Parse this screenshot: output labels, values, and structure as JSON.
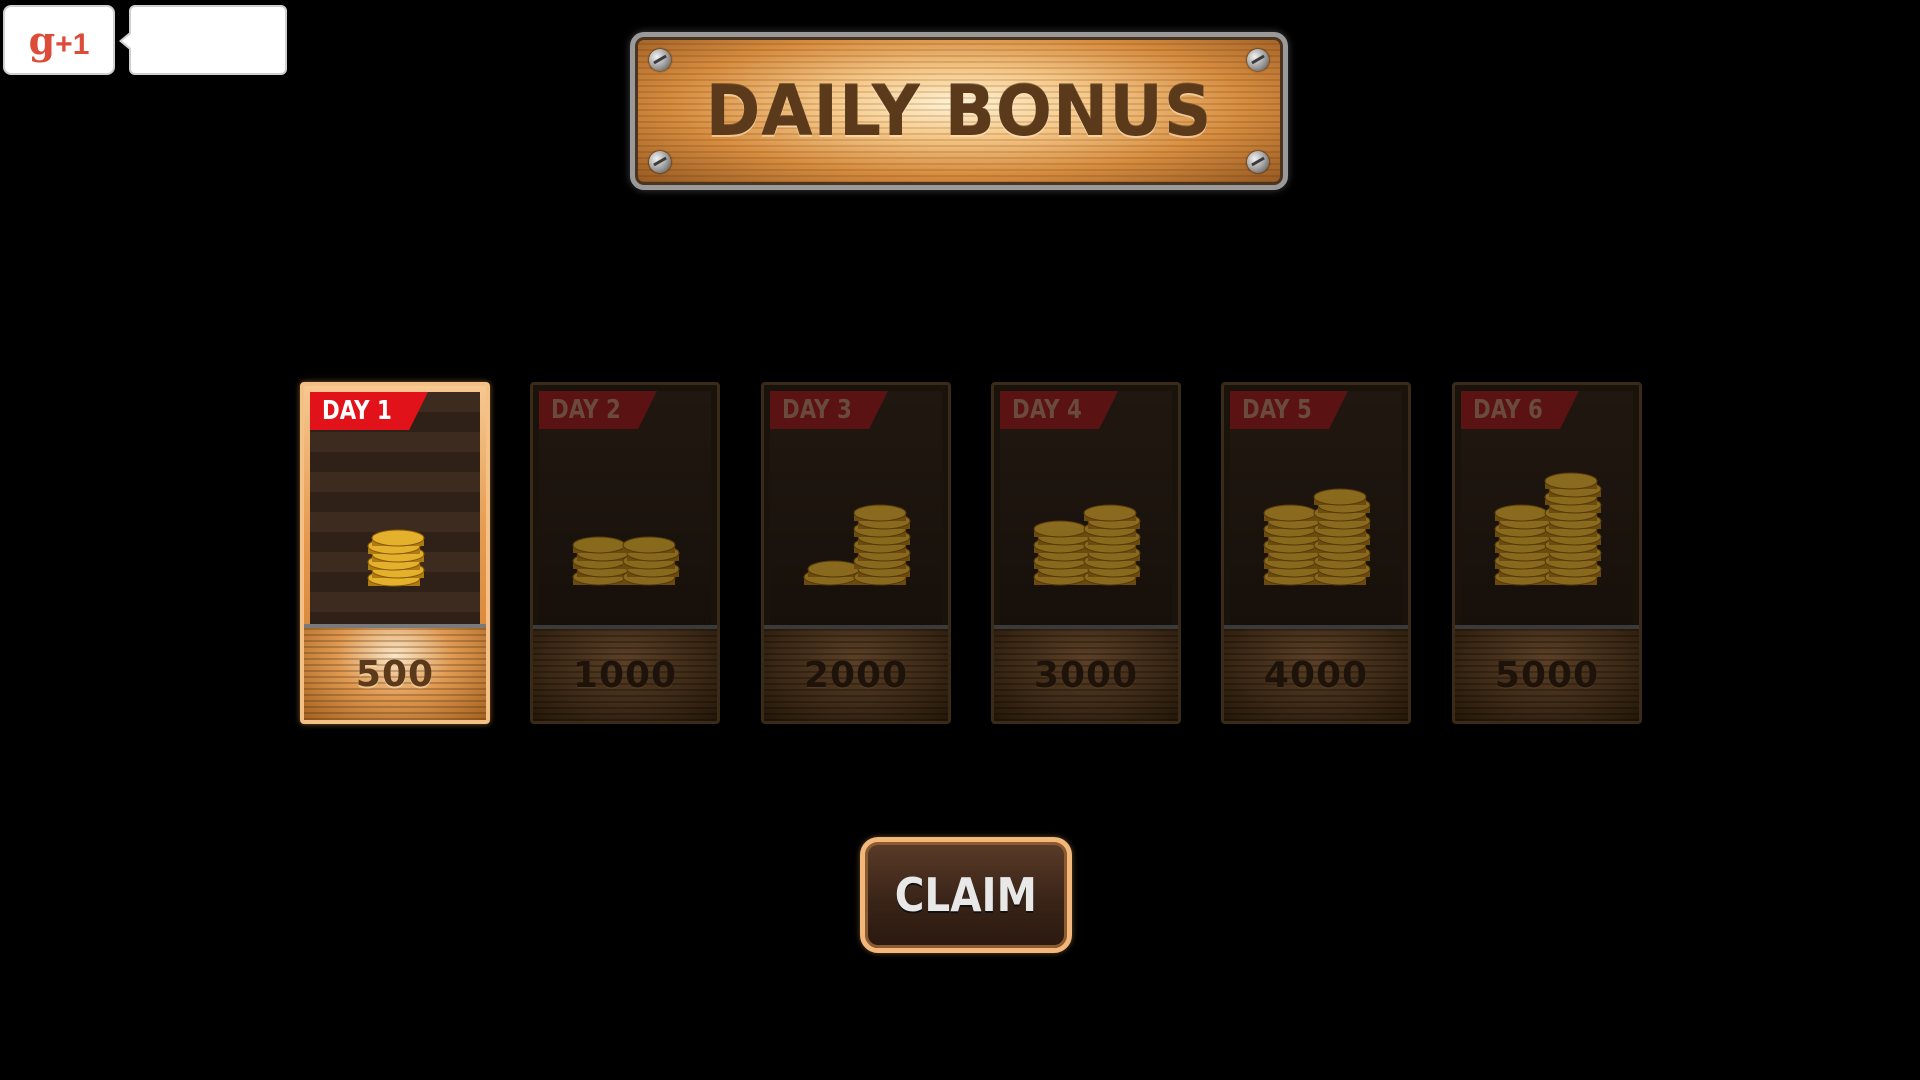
{
  "gplus": {
    "label": "g+1",
    "count": ""
  },
  "title": "DAILY BONUS",
  "days": [
    {
      "label": "DAY 1",
      "amount": "500",
      "active": true,
      "stacks": [
        6
      ]
    },
    {
      "label": "DAY 2",
      "amount": "1000",
      "active": false,
      "stacks": [
        5,
        5
      ]
    },
    {
      "label": "DAY 3",
      "amount": "2000",
      "active": false,
      "stacks": [
        2,
        9
      ]
    },
    {
      "label": "DAY 4",
      "amount": "3000",
      "active": false,
      "stacks": [
        7,
        9
      ]
    },
    {
      "label": "DAY 5",
      "amount": "4000",
      "active": false,
      "stacks": [
        9,
        11
      ]
    },
    {
      "label": "DAY 6",
      "amount": "5000",
      "active": false,
      "stacks": [
        9,
        13
      ]
    }
  ],
  "claim_label": "CLAIM",
  "colors": {
    "active_banner": "#e1121a",
    "inactive_banner": "#5a1212",
    "coin": "#e3b12c",
    "claim_border": "#f3b77a"
  }
}
